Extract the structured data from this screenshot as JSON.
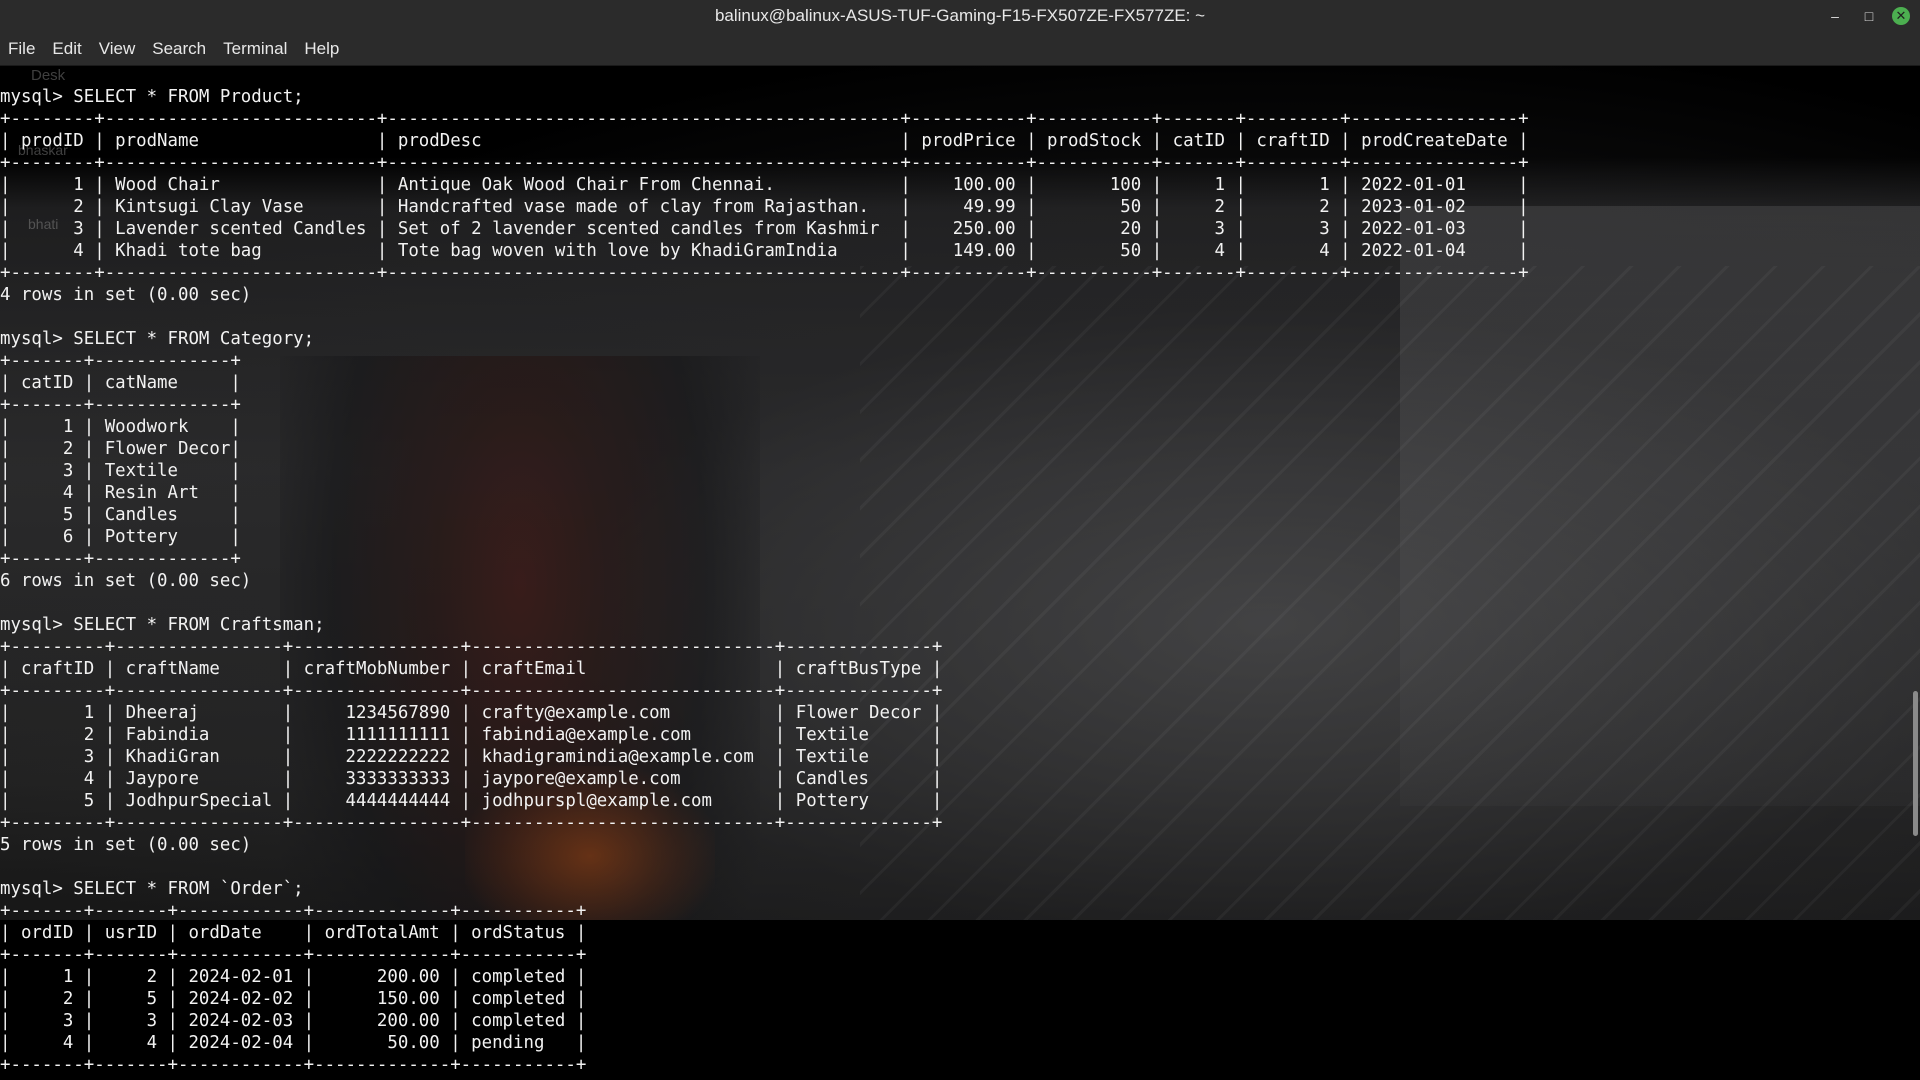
{
  "window": {
    "title": "balinux@balinux-ASUS-TUF-Gaming-F15-FX507ZE-FX577ZE: ~",
    "controls": {
      "minimize": "–",
      "maximize": "□",
      "close": "✕"
    }
  },
  "menubar": {
    "items": [
      "File",
      "Edit",
      "View",
      "Search",
      "Terminal",
      "Help"
    ]
  },
  "desktop_ghost_labels": [
    "Desk",
    "bhaskar",
    "bhati"
  ],
  "terminal": {
    "lines": [
      "mysql> SELECT * FROM Product;",
      "+--------+--------------------------+-------------------------------------------------+-----------+-----------+-------+---------+----------------+",
      "| prodID | prodName                 | prodDesc                                        | prodPrice | prodStock | catID | craftID | prodCreateDate |",
      "+--------+--------------------------+-------------------------------------------------+-----------+-----------+-------+---------+----------------+",
      "|      1 | Wood Chair               | Antique Oak Wood Chair From Chennai.            |    100.00 |       100 |     1 |       1 | 2022-01-01     |",
      "|      2 | Kintsugi Clay Vase       | Handcrafted vase made of clay from Rajasthan.   |     49.99 |        50 |     2 |       2 | 2023-01-02     |",
      "|      3 | Lavender scented Candles | Set of 2 lavender scented candles from Kashmir  |    250.00 |        20 |     3 |       3 | 2022-01-03     |",
      "|      4 | Khadi tote bag           | Tote bag woven with love by KhadiGramIndia      |    149.00 |        50 |     4 |       4 | 2022-01-04     |",
      "+--------+--------------------------+-------------------------------------------------+-----------+-----------+-------+---------+----------------+",
      "4 rows in set (0.00 sec)",
      "",
      "mysql> SELECT * FROM Category;",
      "+-------+-------------+",
      "| catID | catName     |",
      "+-------+-------------+",
      "|     1 | Woodwork    |",
      "|     2 | Flower Decor|",
      "|     3 | Textile     |",
      "|     4 | Resin Art   |",
      "|     5 | Candles     |",
      "|     6 | Pottery     |",
      "+-------+-------------+",
      "6 rows in set (0.00 sec)",
      "",
      "mysql> SELECT * FROM Craftsman;",
      "+---------+----------------+----------------+-----------------------------+--------------+",
      "| craftID | craftName      | craftMobNumber | craftEmail                  | craftBusType |",
      "+---------+----------------+----------------+-----------------------------+--------------+",
      "|       1 | Dheeraj        |     1234567890 | crafty@example.com          | Flower Decor |",
      "|       2 | Fabindia       |     1111111111 | fabindia@example.com        | Textile      |",
      "|       3 | KhadiGran      |     2222222222 | khadigramindia@example.com  | Textile      |",
      "|       4 | Jaypore        |     3333333333 | jaypore@example.com         | Candles      |",
      "|       5 | JodhpurSpecial |     4444444444 | jodhpurspl@example.com      | Pottery      |",
      "+---------+----------------+----------------+-----------------------------+--------------+",
      "5 rows in set (0.00 sec)",
      "",
      "mysql> SELECT * FROM `Order`;",
      "+-------+-------+------------+-------------+-----------+",
      "| ordID | usrID | ordDate    | ordTotalAmt | ordStatus |",
      "+-------+-------+------------+-------------+-----------+",
      "|     1 |     2 | 2024-02-01 |      200.00 | completed |",
      "|     2 |     5 | 2024-02-02 |      150.00 | completed |",
      "|     3 |     3 | 2024-02-03 |      200.00 | completed |",
      "|     4 |     4 | 2024-02-04 |       50.00 | pending   |",
      "+-------+-------+------------+-------------+-----------+"
    ]
  }
}
